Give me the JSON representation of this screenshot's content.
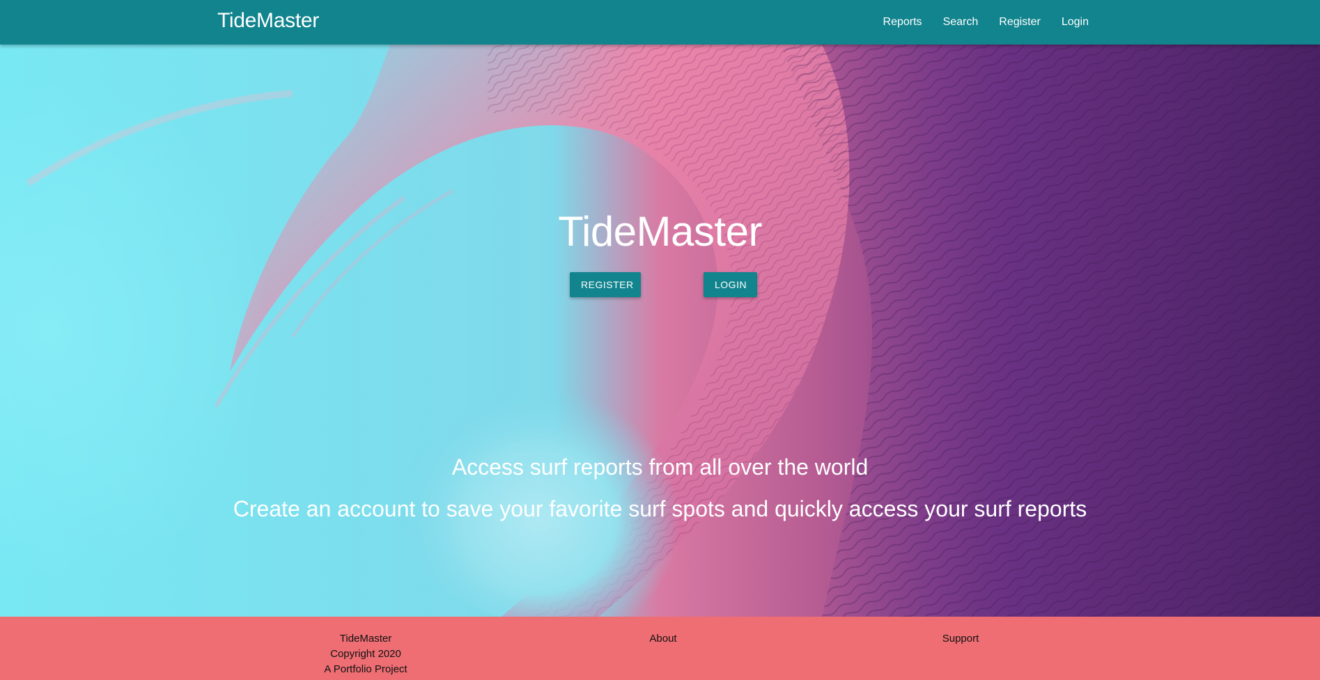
{
  "navbar": {
    "brand": "TideMaster",
    "links": [
      "Reports",
      "Search",
      "Register",
      "Login"
    ],
    "bg_color": "#12848e"
  },
  "hero": {
    "title": "TideMaster",
    "register_button": "REGISTER",
    "login_button": "LOGIN",
    "tagline_1": "Access surf reports from all over the world",
    "tagline_2": "Create an account to save your favorite surf spots and quickly access your surf reports",
    "background_colors": [
      "#6fe3ef",
      "#e77c9f",
      "#4e2466"
    ]
  },
  "footer": {
    "brand": "TideMaster",
    "copyright": "Copyright 2020",
    "tagline": "A Portfolio Project",
    "about": "About",
    "support": "Support",
    "bg_color": "#ee6e73"
  }
}
